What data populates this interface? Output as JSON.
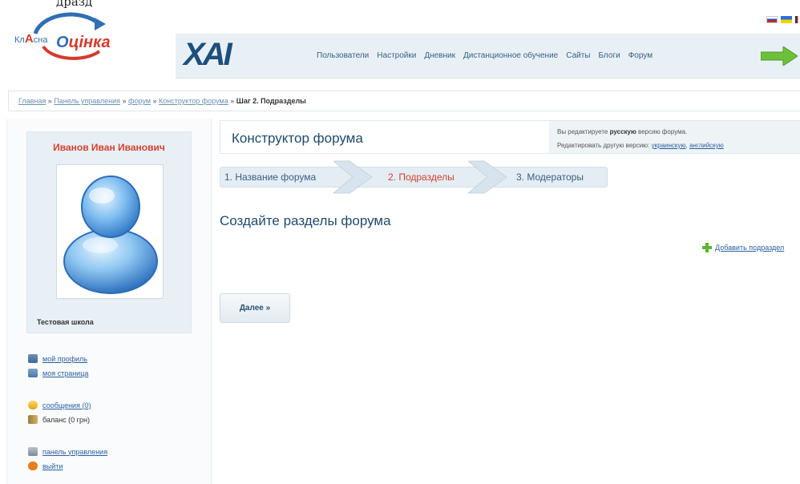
{
  "top_fragment": "дразд",
  "logo": {
    "small": "Кл",
    "mid_letter": "А",
    "small2": "сна",
    "big_blue": "О",
    "big_red": "цінка"
  },
  "brand": {
    "mark": "ХАІ"
  },
  "nav": {
    "items": [
      "Пользователи",
      "Настройки",
      "Дневник",
      "Дистанционное обучение",
      "Сайты",
      "Блоги",
      "Форум"
    ]
  },
  "breadcrumb": {
    "items": [
      "Главная",
      "Панель управления",
      "форум",
      "Конструктор форума"
    ],
    "separator": "»",
    "current": "Шаг 2. Подразделы"
  },
  "profile": {
    "name": "Иванов Иван Иванович",
    "school": "Тестовая школа"
  },
  "sidebar_links": {
    "my_profile": "мой профиль",
    "my_page": "моя страница",
    "messages": "сообщения (0)",
    "balance": "баланс (0 грн)",
    "control_panel": "панель управления",
    "logout": "выйти"
  },
  "constructor": {
    "title": "Конструктор форума",
    "info_line1_pre": "Вы редактируете",
    "info_line1_bold": "русскую",
    "info_line1_post": "версию форума.",
    "info_line2_pre": "Редактировать другую версию:",
    "info_link_ua": "украинскую",
    "info_link_en": "английскую"
  },
  "steps": {
    "step1": "1. Название форума",
    "step2": "2. Подразделы",
    "step3": "3. Модераторы",
    "active": 2
  },
  "section_title": "Создайте разделы форума",
  "add_subsection": "Добавить подраздел",
  "next_button": "Далее »",
  "colors": {
    "accent_red": "#d6402f",
    "link_blue": "#2a5fa0",
    "header_bg": "#e8f0f5",
    "nav_arrow_green": "#5bb532"
  }
}
